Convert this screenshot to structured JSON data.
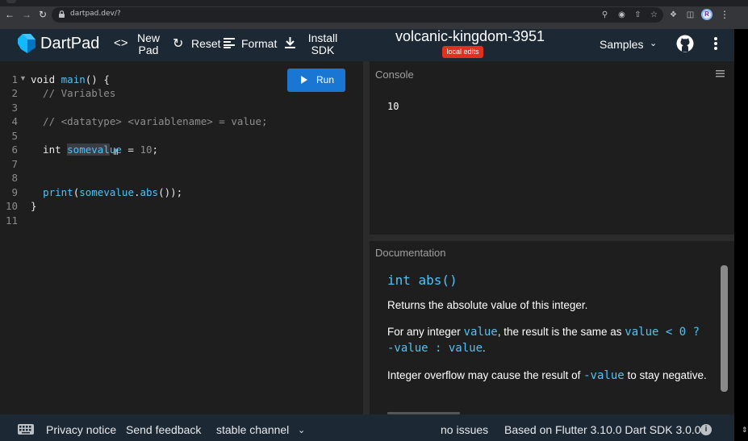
{
  "browser": {
    "url": "dartpad.dev/?"
  },
  "header": {
    "app_name": "DartPad",
    "new_pad_line1": "New",
    "new_pad_line2": "Pad",
    "reset_label": "Reset",
    "format_label": "Format",
    "install_line1": "Install",
    "install_line2": "SDK",
    "pad_name": "volcanic-kingdom-3951",
    "local_edits_badge": "local edits",
    "samples_label": "Samples",
    "avatar_initial": "R"
  },
  "editor": {
    "run_label": "Run",
    "line_numbers": [
      "1",
      "2",
      "3",
      "4",
      "5",
      "6",
      "7",
      "8",
      "9",
      "10",
      "11"
    ],
    "code": {
      "l1_kw": "void ",
      "l1_fn": "main",
      "l1_rest": "() {",
      "l2": "  // Variables",
      "l4": "  // <datatype> <variablename> = value;",
      "l6_type": "  int ",
      "l6_sel": "someval",
      "l6_ident_rest": "ue",
      "l6_eq": " = ",
      "l6_num": "10",
      "l6_end": ";",
      "l9_indent": "  ",
      "l9_fn": "print",
      "l9_p1": "(",
      "l9_arg": "somevalue",
      "l9_dot": ".",
      "l9_method": "abs",
      "l9_end": "());",
      "l10": "}"
    }
  },
  "console": {
    "title": "Console",
    "output": "10"
  },
  "documentation": {
    "title": "Documentation",
    "signature": "int abs()",
    "p1": "Returns the absolute value of this integer.",
    "p2_a": "For any integer ",
    "p2_code1": "value",
    "p2_b": ", the result is the same as ",
    "p2_code2": "value < 0 ? -value : value",
    "p2_c": ".",
    "p3_a": "Integer overflow may cause the result of ",
    "p3_code": "-value",
    "p3_b": " to stay negative."
  },
  "footer": {
    "privacy_notice": "Privacy notice",
    "send_feedback": "Send feedback",
    "channel": "stable channel",
    "issues": "no issues",
    "sdk_info": "Based on Flutter 3.10.0 Dart SDK 3.0.0"
  },
  "colors": {
    "appbar_bg": "#1c2834",
    "editor_bg": "#1e1e1e",
    "run_button": "#1976d2",
    "badge_red": "#e0311f",
    "code_accent": "#4fc3f7"
  }
}
